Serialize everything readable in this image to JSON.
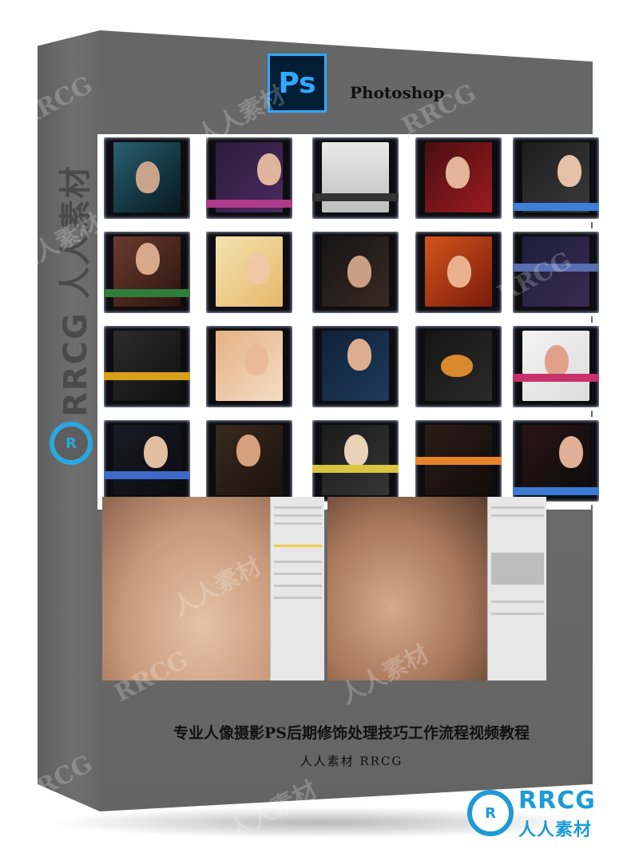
{
  "product": {
    "logo_text": "Ps",
    "title": "Photoshop",
    "caption": "专业人像摄影PS后期修饰处理技巧工作流程视频教程",
    "subcaption": "人人素材 RRCG"
  },
  "spine": {
    "brand_text": "RRCG 人人素材",
    "logo_text": "R"
  },
  "watermark": {
    "latin": "RRCG",
    "cjk": "人人素材"
  },
  "badge": {
    "logo_text": "R",
    "line1": "RRCG",
    "line2": "人人素材"
  },
  "colors": {
    "box_gray": "#676767",
    "ps_blue": "#31a8ff",
    "ps_navy": "#001e36",
    "brand_blue": "#1d9bd7"
  }
}
